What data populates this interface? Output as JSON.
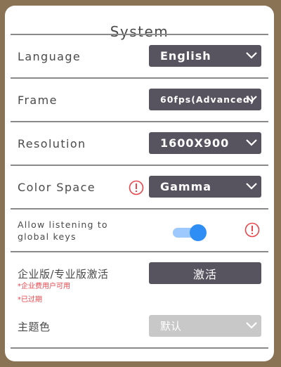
{
  "panel": {
    "title": "System"
  },
  "settings": {
    "language": {
      "label": "Language",
      "value": "English"
    },
    "frame": {
      "label": "Frame",
      "value": "60fps(Advanced)"
    },
    "resolution": {
      "label": "Resolution",
      "value": "1600X900"
    },
    "color_space": {
      "label": "Color Space",
      "value": "Gamma",
      "info_icon": "exclamation-circle-icon"
    },
    "global_keys": {
      "label_line1": "Allow listening to",
      "label_line2": "global keys",
      "enabled": true,
      "info_icon": "exclamation-circle-icon"
    },
    "edition": {
      "label": "企业版/专业版激活",
      "button_label": "激活",
      "note_enterprise": "*企业费用户可用",
      "note_expired": "*已过期"
    },
    "theme_color": {
      "label": "主题色",
      "value": "默认",
      "disabled": true
    }
  },
  "colors": {
    "select_bg": "#57535f",
    "accent": "#2f8ef5",
    "warning": "#e9454b",
    "disabled": "#c8c8c8"
  }
}
